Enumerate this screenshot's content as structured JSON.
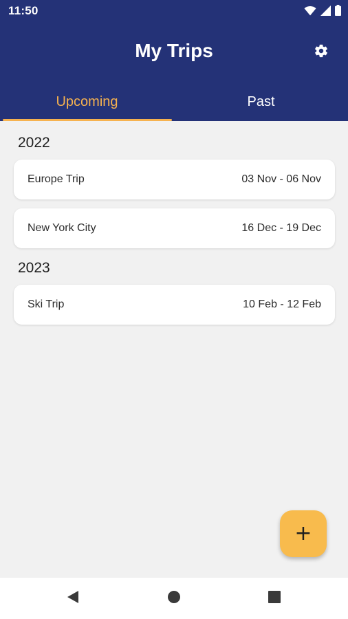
{
  "status_bar": {
    "time": "11:50",
    "icons": [
      "wifi-icon",
      "signal-icon",
      "battery-icon"
    ]
  },
  "header": {
    "title": "My Trips",
    "settings_icon": "gear-icon"
  },
  "tabs": [
    {
      "label": "Upcoming",
      "selected": true
    },
    {
      "label": "Past",
      "selected": false
    }
  ],
  "sections": [
    {
      "year": "2022",
      "trips": [
        {
          "name": "Europe Trip",
          "dates": "03 Nov - 06 Nov"
        },
        {
          "name": "New York City",
          "dates": "16 Dec - 19 Dec"
        }
      ]
    },
    {
      "year": "2023",
      "trips": [
        {
          "name": "Ski Trip",
          "dates": "10 Feb - 12 Feb"
        }
      ]
    }
  ],
  "fab": {
    "label": "+",
    "icon": "plus-icon"
  },
  "nav_bar": {
    "icons": [
      "back-icon",
      "home-icon",
      "recents-icon"
    ]
  },
  "colors": {
    "header": "#243277",
    "accent": "#f6b24f",
    "fab": "#f8bb4d",
    "background": "#f1f1f1"
  }
}
